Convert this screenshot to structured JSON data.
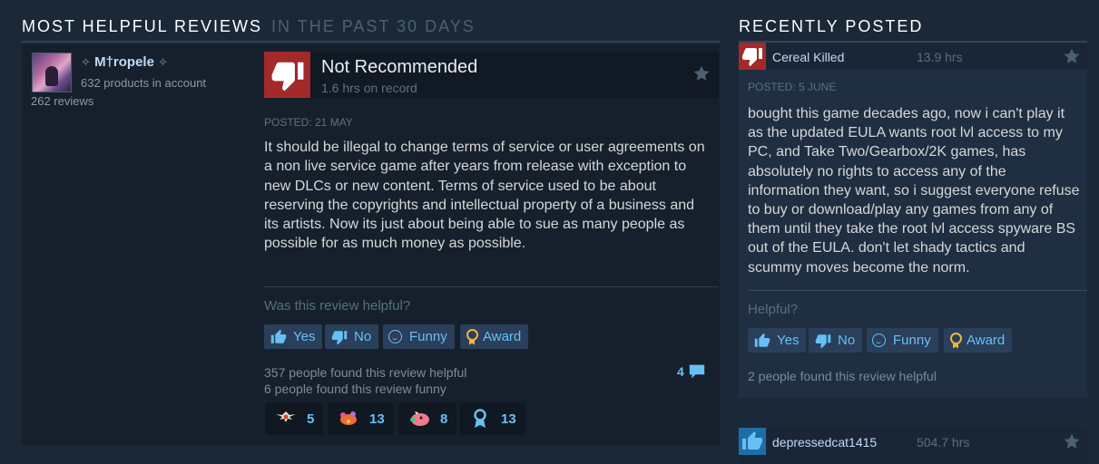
{
  "most_helpful": {
    "title": "Most Helpful Reviews",
    "subtitle": "In the past 30 days",
    "review": {
      "author": "M†ropele",
      "author_deco_left": "✧",
      "author_deco_right": "✧",
      "products_in_account": "632 products in account",
      "reviews_count": "262 reviews",
      "verdict": "Not Recommended",
      "hours_on_record": "1.6 hrs on record",
      "posted": "Posted: 21 May",
      "body": "It should be illegal to change terms of service or user agreements on a non live service game after years from release with exception to new DLCs or new content. Terms of service used to be about reserving the copyrights and intellectual property of a business and its artists. Now its just about being able to sue as many people as possible for as much money as possible.",
      "helpful_question": "Was this review helpful?",
      "buttons": {
        "yes": "Yes",
        "no": "No",
        "funny": "Funny",
        "award": "Award"
      },
      "found_helpful": "357 people found this review helpful",
      "found_funny": "6 people found this review funny",
      "comment_count": "4",
      "awards": [
        {
          "icon": "winged-award-icon",
          "count": "5"
        },
        {
          "icon": "candy-award-icon",
          "count": "13"
        },
        {
          "icon": "pig-award-icon",
          "count": "8"
        },
        {
          "icon": "ribbon-award-icon",
          "count": "13"
        }
      ]
    }
  },
  "recently_posted": {
    "title": "Recently Posted",
    "items": [
      {
        "author": "Cereal Killed",
        "hours": "13.9 hrs",
        "recommended": false,
        "posted": "Posted: 5 June",
        "body": "bought this game decades ago, now i can't play it as the updated EULA wants root lvl access to my PC, and Take Two/Gearbox/2K games, has absolutely no rights to access any of the information they want, so i suggest everyone refuse to buy or download/play any games from any of them until they take the root lvl access spyware BS out of the EULA. don't let shady tactics and scummy moves become the norm.",
        "helpful_question": "Helpful?",
        "buttons": {
          "yes": "Yes",
          "no": "No",
          "funny": "Funny",
          "award": "Award"
        },
        "found_helpful": "2 people found this review helpful"
      },
      {
        "author": "depressedcat1415",
        "hours": "504.7 hrs",
        "recommended": true
      }
    ]
  },
  "colors": {
    "background": "#1b2838",
    "link_blue": "#66c0f4",
    "thumb_down_red": "#a3292a",
    "thumb_up_blue": "#1a9fff",
    "award_gold": "#f2b33c"
  }
}
